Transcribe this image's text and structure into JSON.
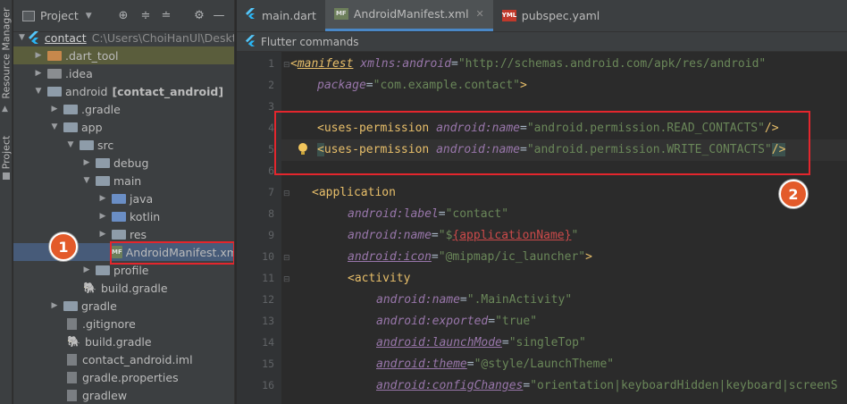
{
  "side_stripe": {
    "resource_manager": "Resource Manager",
    "project": "Project"
  },
  "project_panel": {
    "title": "Project",
    "root": {
      "name": "contact",
      "path": "C:\\Users\\ChoiHanUl\\Deskt"
    },
    "items": [
      {
        "label": ".dart_tool",
        "suffix": ""
      },
      {
        "label": ".idea",
        "suffix": ""
      },
      {
        "label": "android",
        "suffix": "[contact_android]"
      },
      {
        "label": ".gradle",
        "suffix": ""
      },
      {
        "label": "app",
        "suffix": ""
      },
      {
        "label": "src",
        "suffix": ""
      },
      {
        "label": "debug",
        "suffix": ""
      },
      {
        "label": "main",
        "suffix": ""
      },
      {
        "label": "java",
        "suffix": ""
      },
      {
        "label": "kotlin",
        "suffix": ""
      },
      {
        "label": "res",
        "suffix": ""
      },
      {
        "label": "AndroidManifest.xml",
        "suffix": ""
      },
      {
        "label": "profile",
        "suffix": ""
      },
      {
        "label": "build.gradle",
        "suffix": ""
      },
      {
        "label": "gradle",
        "suffix": ""
      },
      {
        "label": ".gitignore",
        "suffix": ""
      },
      {
        "label": "build.gradle",
        "suffix": ""
      },
      {
        "label": "contact_android.iml",
        "suffix": ""
      },
      {
        "label": "gradle.properties",
        "suffix": ""
      },
      {
        "label": "gradlew",
        "suffix": ""
      }
    ]
  },
  "tabs": [
    {
      "label": "main.dart",
      "active": false
    },
    {
      "label": "AndroidManifest.xml",
      "active": true
    },
    {
      "label": "pubspec.yaml",
      "active": false
    }
  ],
  "flutter_bar": {
    "label": "Flutter commands"
  },
  "line_numbers": [
    "1",
    "2",
    "3",
    "4",
    "5",
    "6",
    "7",
    "8",
    "9",
    "10",
    "11",
    "12",
    "13",
    "14",
    "15",
    "16"
  ],
  "code": {
    "l1_tag": "manifest",
    "l1_attr": "xmlns:android",
    "l1_val": "\"http://schemas.android.com/apk/res/android\"",
    "l2_attr": "package",
    "l2_val": "\"com.example.contact\"",
    "l4_tag": "uses-permission",
    "l4_attr": "android:name",
    "l4_val": "\"android.permission.READ_CONTACTS\"",
    "l5_tag": "uses-permission",
    "l5_attr": "android:name",
    "l5_val": "\"android.permission.WRITE_CONTACTS\"",
    "l7_tag": "application",
    "l8_attr": "android:label",
    "l8_val": "\"contact\"",
    "l9_attr": "android:name",
    "l9_val_pre": "\"$",
    "l9_val_ph": "{applicationName}",
    "l9_val_post": "\"",
    "l10_attr": "android:icon",
    "l10_val": "\"@mipmap/ic_launcher\"",
    "l11_tag": "activity",
    "l12_attr": "android:name",
    "l12_val": "\".MainActivity\"",
    "l13_attr": "android:exported",
    "l13_val": "\"true\"",
    "l14_attr": "android:launchMode",
    "l14_val": "\"singleTop\"",
    "l15_attr": "android:theme",
    "l15_val": "\"@style/LaunchTheme\"",
    "l16_attr": "android:configChanges",
    "l16_val": "\"orientation|keyboardHidden|keyboard|screenS"
  },
  "annotations": {
    "badge1": "1",
    "badge2": "2"
  },
  "colors": {
    "highlight_box": "#e3262d",
    "badge": "#e35a2a",
    "tab_underline": "#4a88c7"
  }
}
